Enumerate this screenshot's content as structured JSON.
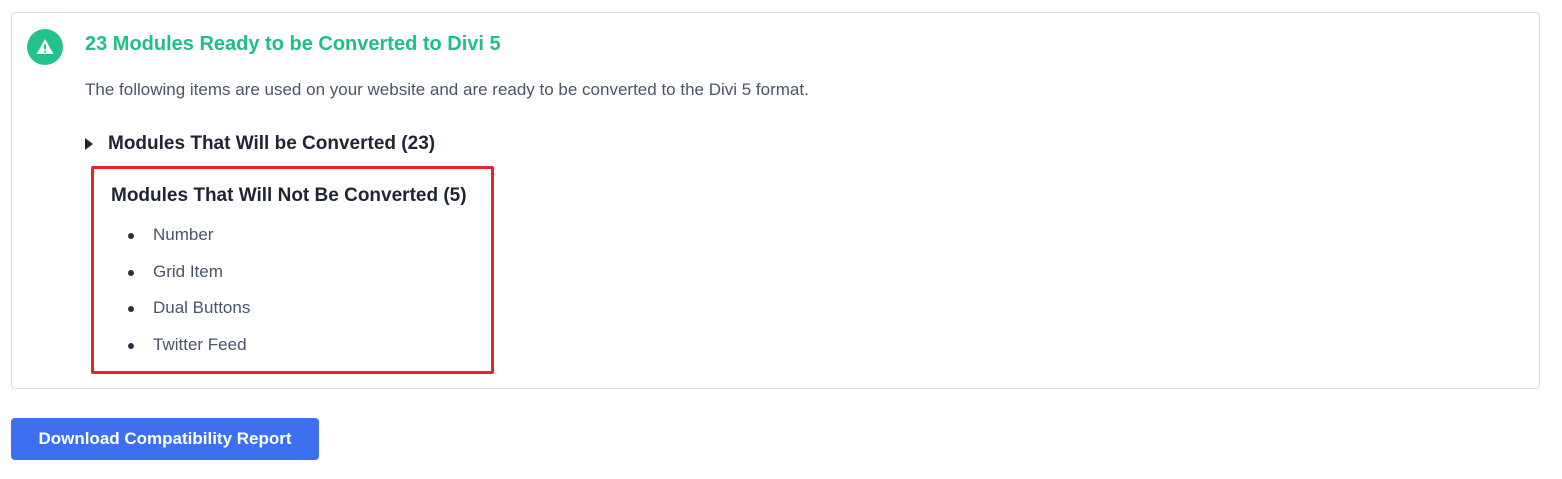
{
  "notice": {
    "icon": "warning-icon",
    "title": "23 Modules Ready to be Converted to Divi 5",
    "description": "The following items are used on your website and are ready to be converted to the Divi 5 format.",
    "converted_toggle_label": "Modules That Will be Converted (23)",
    "not_converted": {
      "heading": "Modules That Will Not Be Converted (5)",
      "items": [
        {
          "label": "Number"
        },
        {
          "label": "Grid Item"
        },
        {
          "label": "Dual Buttons"
        },
        {
          "label": "Twitter Feed"
        }
      ]
    }
  },
  "actions": {
    "download_label": "Download Compatibility Report"
  },
  "colors": {
    "accent_green": "#1fbf85",
    "highlight_red": "#e3242b",
    "button_blue": "#3d70f0"
  }
}
